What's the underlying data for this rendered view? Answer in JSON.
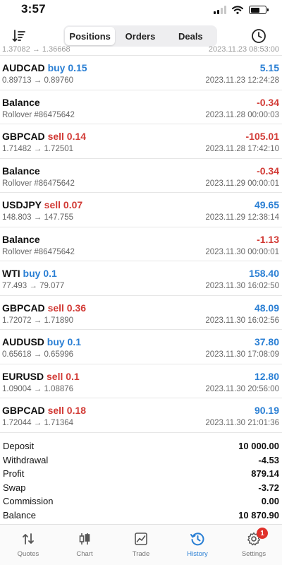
{
  "status_bar": {
    "time": "3:57"
  },
  "header": {
    "tabs": [
      {
        "label": "Positions",
        "active": true
      },
      {
        "label": "Orders",
        "active": false
      },
      {
        "label": "Deals",
        "active": false
      }
    ],
    "left_icon": "sort-icon",
    "right_icon": "clock-history-icon"
  },
  "cut_row": {
    "left": "1.37082 → 1.36668",
    "right": "2023.11.23 08:53:00"
  },
  "deals": [
    {
      "symbol": "AUDCAD",
      "side": "buy 0.15",
      "side_type": "buy",
      "detail": "0.89713 → 0.89760",
      "amount": "5.15",
      "amount_type": "pos",
      "time": "2023.11.23 12:24:28"
    },
    {
      "symbol": "Balance",
      "side": "",
      "side_type": "",
      "detail": "Rollover #86475642",
      "amount": "-0.34",
      "amount_type": "neg",
      "time": "2023.11.28 00:00:03"
    },
    {
      "symbol": "GBPCAD",
      "side": "sell 0.14",
      "side_type": "sell",
      "detail": "1.71482 → 1.72501",
      "amount": "-105.01",
      "amount_type": "neg",
      "time": "2023.11.28 17:42:10"
    },
    {
      "symbol": "Balance",
      "side": "",
      "side_type": "",
      "detail": "Rollover #86475642",
      "amount": "-0.34",
      "amount_type": "neg",
      "time": "2023.11.29 00:00:01"
    },
    {
      "symbol": "USDJPY",
      "side": "sell 0.07",
      "side_type": "sell",
      "detail": "148.803 → 147.755",
      "amount": "49.65",
      "amount_type": "pos",
      "time": "2023.11.29 12:38:14"
    },
    {
      "symbol": "Balance",
      "side": "",
      "side_type": "",
      "detail": "Rollover #86475642",
      "amount": "-1.13",
      "amount_type": "neg",
      "time": "2023.11.30 00:00:01"
    },
    {
      "symbol": "WTI",
      "side": "buy 0.1",
      "side_type": "buy",
      "detail": "77.493 → 79.077",
      "amount": "158.40",
      "amount_type": "pos",
      "time": "2023.11.30 16:02:50"
    },
    {
      "symbol": "GBPCAD",
      "side": "sell 0.36",
      "side_type": "sell",
      "detail": "1.72072 → 1.71890",
      "amount": "48.09",
      "amount_type": "pos",
      "time": "2023.11.30 16:02:56"
    },
    {
      "symbol": "AUDUSD",
      "side": "buy 0.1",
      "side_type": "buy",
      "detail": "0.65618 → 0.65996",
      "amount": "37.80",
      "amount_type": "pos",
      "time": "2023.11.30 17:08:09"
    },
    {
      "symbol": "EURUSD",
      "side": "sell 0.1",
      "side_type": "sell",
      "detail": "1.09004 → 1.08876",
      "amount": "12.80",
      "amount_type": "pos",
      "time": "2023.11.30 20:56:00"
    },
    {
      "symbol": "GBPCAD",
      "side": "sell 0.18",
      "side_type": "sell",
      "detail": "1.72044 → 1.71364",
      "amount": "90.19",
      "amount_type": "pos",
      "time": "2023.11.30 21:01:36"
    }
  ],
  "summary": [
    {
      "label": "Deposit",
      "value": "10 000.00"
    },
    {
      "label": "Withdrawal",
      "value": "-4.53"
    },
    {
      "label": "Profit",
      "value": "879.14"
    },
    {
      "label": "Swap",
      "value": "-3.72"
    },
    {
      "label": "Commission",
      "value": "0.00"
    },
    {
      "label": "Balance",
      "value": "10 870.90"
    }
  ],
  "tabbar": [
    {
      "label": "Quotes",
      "icon": "quotes-arrows-icon",
      "active": false
    },
    {
      "label": "Chart",
      "icon": "candlestick-chart-icon",
      "active": false
    },
    {
      "label": "Trade",
      "icon": "trade-chart-icon",
      "active": false
    },
    {
      "label": "History",
      "icon": "history-clock-icon",
      "active": true
    },
    {
      "label": "Settings",
      "icon": "gear-icon",
      "active": false,
      "badge": "1"
    }
  ],
  "colors": {
    "accent": "#2a7fd4",
    "negative": "#d23b36"
  }
}
